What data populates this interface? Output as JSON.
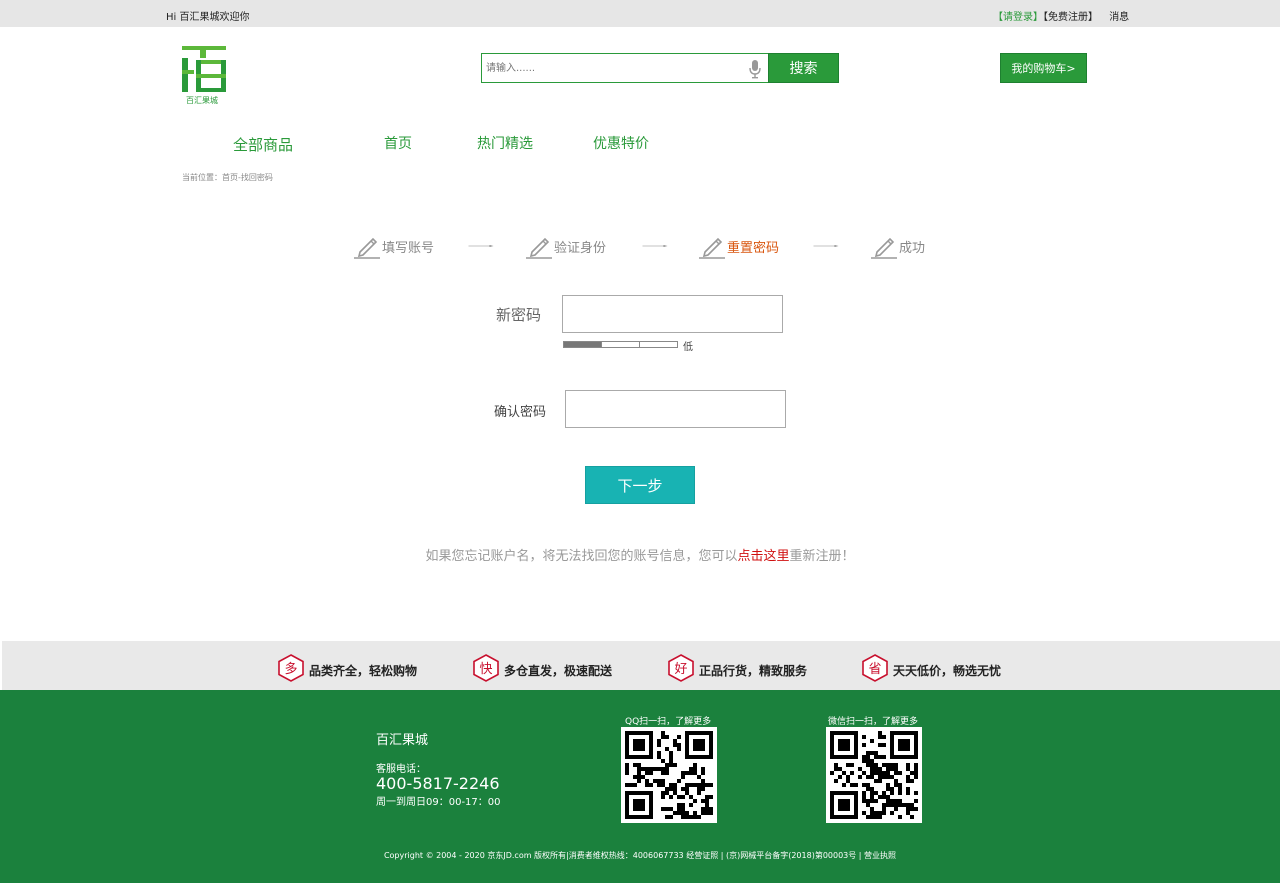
{
  "topbar": {
    "welcome": "Hi 百汇果城欢迎你",
    "login": "【请登录】",
    "register": "【免费注册】",
    "messages": "消息"
  },
  "logo": {
    "text": "百汇果城"
  },
  "search": {
    "placeholder": "请输入......",
    "button": "搜索"
  },
  "cart": {
    "label": "我的购物车>"
  },
  "nav": {
    "all": "全部商品",
    "items": [
      "首页",
      "热门精选",
      "优惠特价"
    ]
  },
  "breadcrumb": "当前位置：首页-找回密码",
  "steps": [
    {
      "label": "填写账号",
      "active": false
    },
    {
      "label": "验证身份",
      "active": false
    },
    {
      "label": "重置密码",
      "active": true
    },
    {
      "label": "成功",
      "active": false
    }
  ],
  "form": {
    "new_password_label": "新密码",
    "strength_label": "低",
    "strength_level": 0.33,
    "confirm_label": "确认密码",
    "next_button": "下一步"
  },
  "forgot": {
    "prefix": "如果您忘记账户名，将无法找回您的账号信息，您可以",
    "link": "点击这里",
    "suffix": "重新注册！"
  },
  "features": [
    {
      "badge": "多",
      "text": "品类齐全，轻松购物"
    },
    {
      "badge": "快",
      "text": "多仓直发，极速配送"
    },
    {
      "badge": "好",
      "text": "正品行货，精致服务"
    },
    {
      "badge": "省",
      "text": "天天低价，畅选无忧"
    }
  ],
  "footer": {
    "brand": "百汇果城",
    "service_label": "客服电话：",
    "phone": "400-5817-2246",
    "hours": "周一到周日09：00-17：00",
    "qq_label": "QQ扫一扫，了解更多",
    "wechat_label": "微信扫一扫，了解更多",
    "copyright": "Copyright © 2004 - 2020 京东JD.com 版权所有|消费者维权热线：4006067733 经营证照 | (京)网械平台备字(2018)第00003号 | 营业执照"
  },
  "colors": {
    "brand_green": "#2a9a3a",
    "footer_green": "#1b813d",
    "accent_teal": "#18b3b3",
    "active_step": "#d9560f",
    "link_red": "#d01010"
  }
}
